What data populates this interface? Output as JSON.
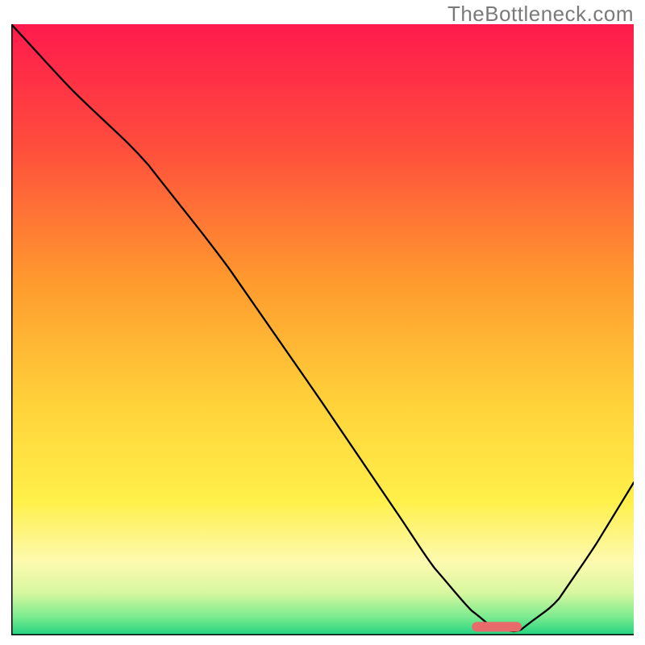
{
  "watermark": "TheBottleneck.com",
  "chart_data": {
    "type": "line",
    "title": "",
    "xlabel": "",
    "ylabel": "",
    "xlim": [
      0,
      100
    ],
    "ylim": [
      0,
      100
    ],
    "grid": false,
    "legend": false,
    "series": [
      {
        "name": "curve",
        "x": [
          0,
          10,
          22,
          35,
          50,
          62,
          68,
          74,
          78,
          82,
          88,
          94,
          100
        ],
        "y": [
          100,
          89,
          77,
          60,
          38,
          20,
          11,
          4,
          1,
          1,
          6,
          15,
          25
        ]
      }
    ],
    "marker": {
      "name": "optimal-zone",
      "x_center": 78,
      "y_center": 1.4,
      "width": 8,
      "height": 1.6,
      "color": "#e86a6a"
    },
    "gradient_stops": [
      {
        "offset": 0.0,
        "color": "#ff1a4d"
      },
      {
        "offset": 0.2,
        "color": "#ff4d3d"
      },
      {
        "offset": 0.42,
        "color": "#ff9a2e"
      },
      {
        "offset": 0.62,
        "color": "#ffd23a"
      },
      {
        "offset": 0.78,
        "color": "#fff04a"
      },
      {
        "offset": 0.88,
        "color": "#fdfab0"
      },
      {
        "offset": 0.93,
        "color": "#d8f7a0"
      },
      {
        "offset": 0.97,
        "color": "#7beb8f"
      },
      {
        "offset": 1.0,
        "color": "#21d281"
      }
    ],
    "axis_stroke": "#000000",
    "curve_stroke": "#000000",
    "curve_stroke_width": 2.3
  }
}
